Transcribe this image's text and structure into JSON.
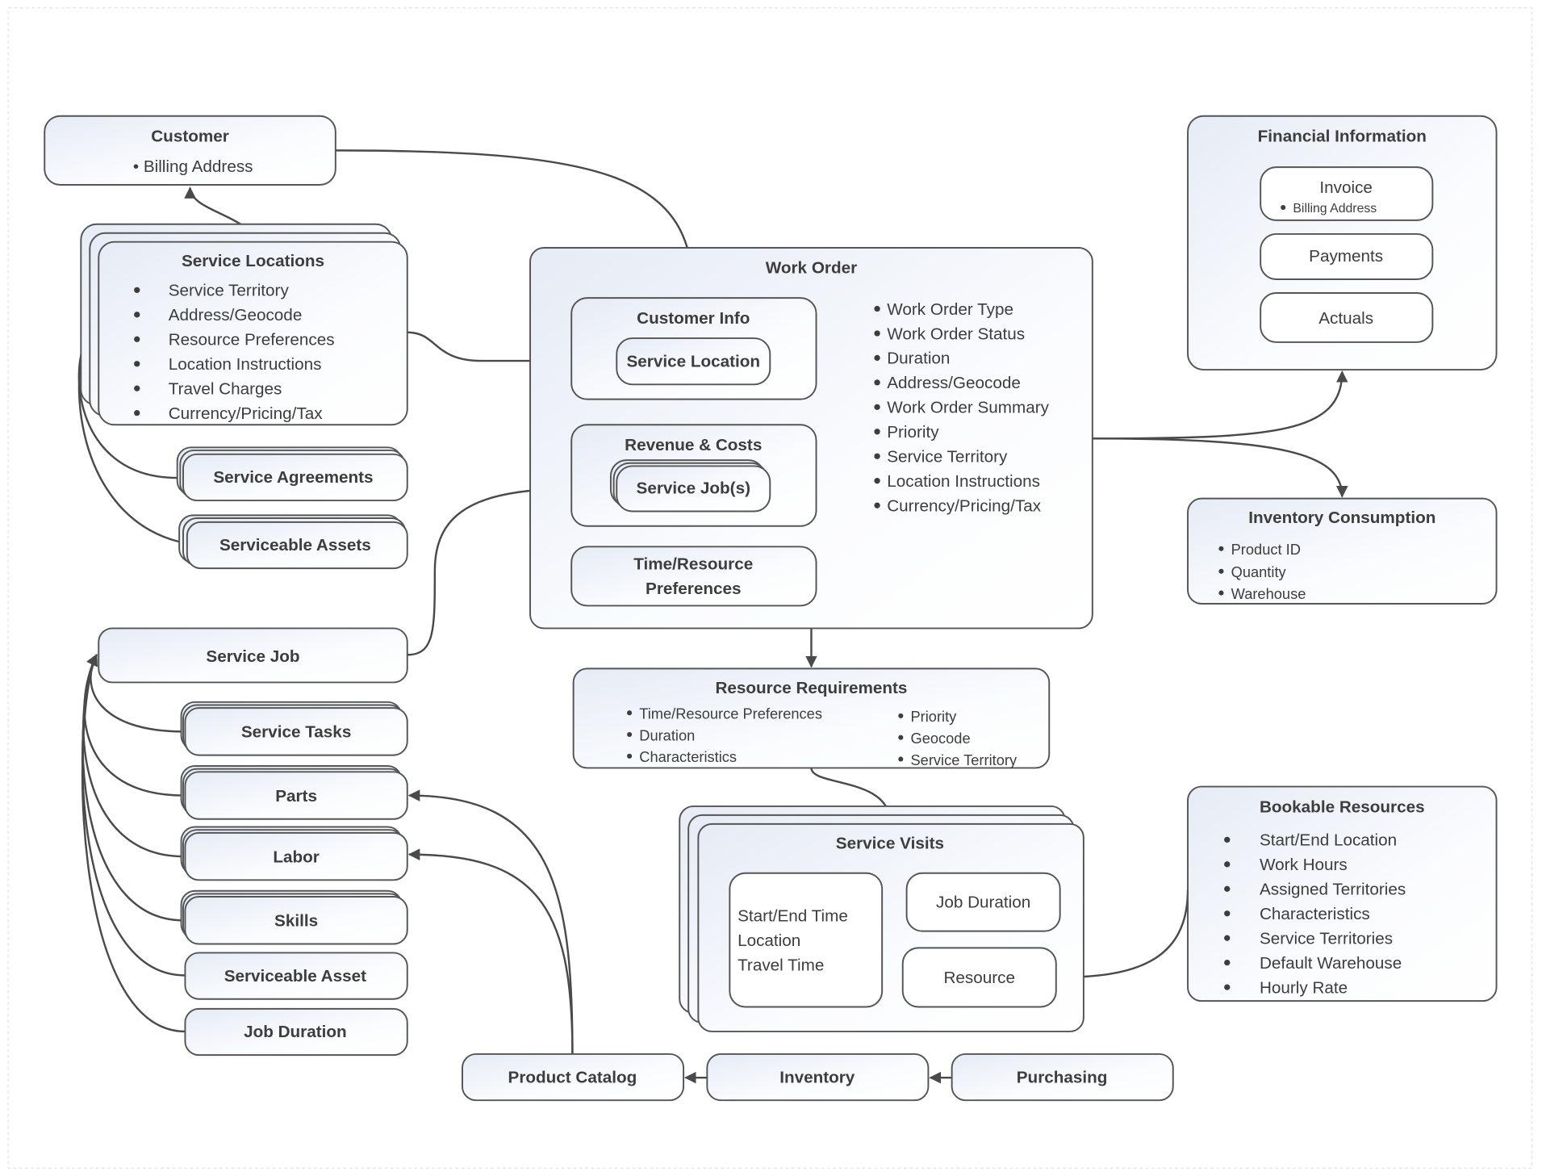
{
  "customer": {
    "title": "Customer",
    "items": [
      "• Billing Address"
    ]
  },
  "service_locations": {
    "title": "Service Locations",
    "items": [
      "Service Territory",
      "Address/Geocode",
      "Resource Preferences",
      "Location Instructions",
      "Travel Charges",
      "Currency/Pricing/Tax"
    ]
  },
  "service_agreements": "Service Agreements",
  "serviceable_assets": "Serviceable Assets",
  "service_job": "Service Job",
  "service_job_children": [
    "Service Tasks",
    "Parts",
    "Labor",
    "Skills",
    "Serviceable Asset",
    "Job Duration"
  ],
  "work_order": {
    "title": "Work Order",
    "customer_info": {
      "title": "Customer Info",
      "service_location": "Service Location"
    },
    "revenue_costs": {
      "title": "Revenue & Costs",
      "service_jobs": "Service Job(s)"
    },
    "time_resource": [
      "Time/Resource",
      "Preferences"
    ],
    "items": [
      "Work Order Type",
      "Work Order Status",
      "Duration",
      "Address/Geocode",
      "Work Order Summary",
      "Priority",
      "Service Territory",
      "Location Instructions",
      "Currency/Pricing/Tax"
    ]
  },
  "financial": {
    "title": "Financial Information",
    "invoice": "Invoice",
    "invoice_item": "Billing Address",
    "payments": "Payments",
    "actuals": "Actuals"
  },
  "inventory_consumption": {
    "title": "Inventory Consumption",
    "items": [
      "Product ID",
      "Quantity",
      "Warehouse"
    ]
  },
  "resource_requirements": {
    "title": "Resource Requirements",
    "left": [
      "Time/Resource Preferences",
      "Duration",
      "Characteristics"
    ],
    "right": [
      "Priority",
      "Geocode",
      "Service Territory"
    ]
  },
  "service_visits": {
    "title": "Service Visits",
    "details": [
      "Start/End Time",
      "Location",
      "Travel Time"
    ],
    "job_duration": "Job Duration",
    "resource": "Resource"
  },
  "bookable_resources": {
    "title": "Bookable Resources",
    "items": [
      "Start/End Location",
      "Work Hours",
      "Assigned Territories",
      "Characteristics",
      "Service Territories",
      "Default Warehouse",
      "Hourly Rate"
    ]
  },
  "supply_chain": [
    "Product Catalog",
    "Inventory",
    "Purchasing"
  ],
  "colors": {
    "stroke": "#555555",
    "text": "#3d3d3d",
    "fill_start": "#e6ebf5",
    "fill_end": "#ffffff"
  }
}
